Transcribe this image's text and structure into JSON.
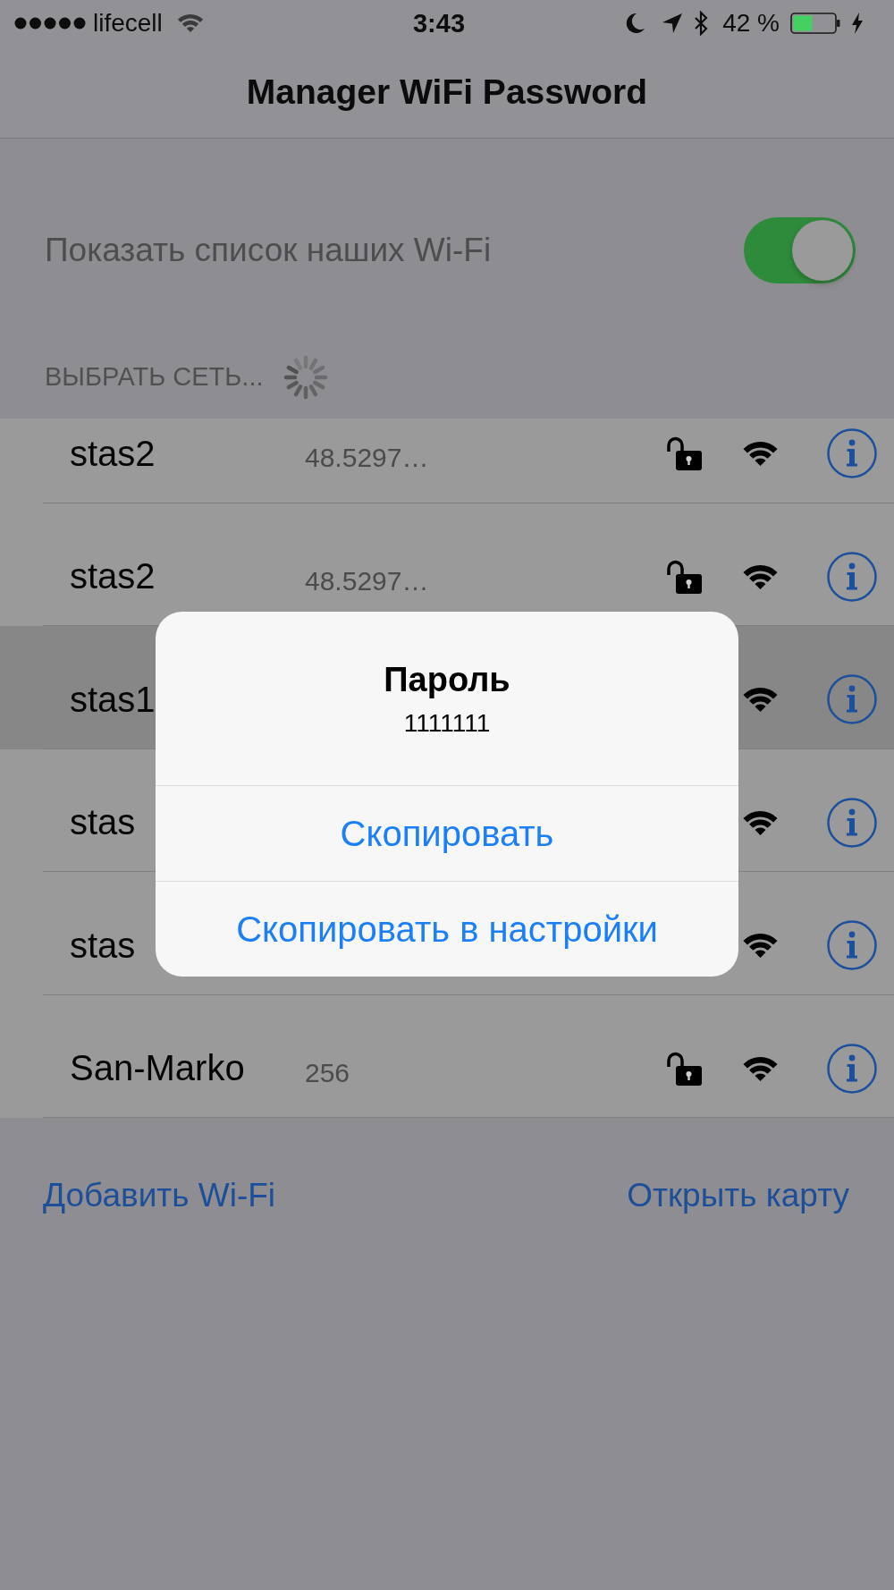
{
  "status_bar": {
    "carrier": "lifecell",
    "time": "3:43",
    "battery": "42 %"
  },
  "nav_bar": {
    "title": "Manager WiFi Password"
  },
  "toggle_row": {
    "label": "Показать список наших Wi-Fi",
    "on": true
  },
  "section_header": {
    "title": "ВЫБРАТЬ СЕТЬ...",
    "loading": true
  },
  "networks": [
    {
      "name": "stas2",
      "detail": "48.5297…",
      "locked": false,
      "selected": false
    },
    {
      "name": "stas2",
      "detail": "48.5297…",
      "locked": false,
      "selected": false
    },
    {
      "name": "stas1",
      "selected": true
    },
    {
      "name": "stas",
      "selected": false
    },
    {
      "name": "stas",
      "selected": false
    },
    {
      "name": "San-Marko",
      "detail": "256",
      "locked": false,
      "selected": false
    }
  ],
  "footer_links": [
    {
      "label": "Добавить Wi-Fi"
    },
    {
      "label": "Открыть карту"
    }
  ],
  "alert": {
    "title": "Пароль",
    "message": "1111111",
    "buttons": [
      {
        "label": "Скопировать"
      },
      {
        "label": "Скопировать в настройки"
      }
    ]
  }
}
